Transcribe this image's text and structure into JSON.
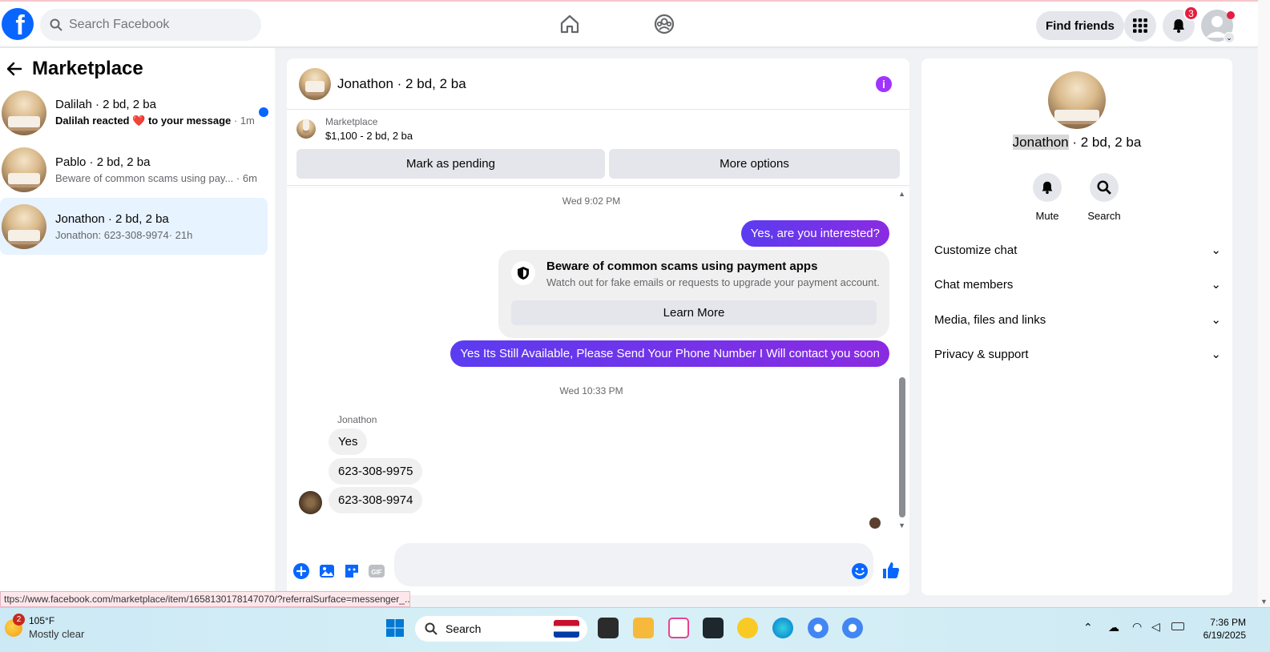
{
  "topbar": {
    "search_placeholder": "Search Facebook",
    "find_friends": "Find friends",
    "notifications_count": "3"
  },
  "sidebar": {
    "title": "Marketplace",
    "conversations": [
      {
        "name": "Dalilah · 2 bd, 2 ba",
        "preview_pre": "Dalilah reacted",
        "preview_post": "to your message",
        "time": "· 1m",
        "unread": true
      },
      {
        "name": "Pablo · 2 bd, 2 ba",
        "preview": "Beware of common scams using pay...",
        "time": "· 6m"
      },
      {
        "name": "Jonathon · 2 bd, 2 ba",
        "preview": "Jonathon: 623-308-9974",
        "time": "· 21h",
        "active": true
      }
    ]
  },
  "chat": {
    "title": "Jonathon · 2 bd, 2 ba",
    "listing_label": "Marketplace",
    "listing_price": "$1,100 - 2 bd, 2 ba",
    "mark_pending": "Mark as pending",
    "more_options": "More options",
    "time1": "Wed 9:02 PM",
    "msg_out1": "Yes, are you interested?",
    "scam_title": "Beware of common scams using payment apps",
    "scam_body": "Watch out for fake emails or requests to upgrade your payment account.",
    "learn_more": "Learn More",
    "msg_out2": "Yes Its Still Available, Please Send Your Phone Number I Will contact you soon",
    "time2": "Wed 10:33 PM",
    "sender": "Jonathon",
    "msg_in": [
      "Yes",
      "623-308-9975",
      "623-308-9974"
    ]
  },
  "right": {
    "name_first": "Jonathon",
    "name_rest": " · 2 bd, 2 ba",
    "mute": "Mute",
    "search": "Search",
    "rows": [
      "Customize chat",
      "Chat members",
      "Media, files and links",
      "Privacy & support"
    ]
  },
  "status_url": "ttps://www.facebook.com/marketplace/item/1658130178147070/?referralSurface=messenger_...",
  "taskbar": {
    "weather_badge": "2",
    "temp": "105°F",
    "weather": "Mostly clear",
    "search": "Search",
    "time": "7:36 PM",
    "date": "6/19/2025"
  }
}
